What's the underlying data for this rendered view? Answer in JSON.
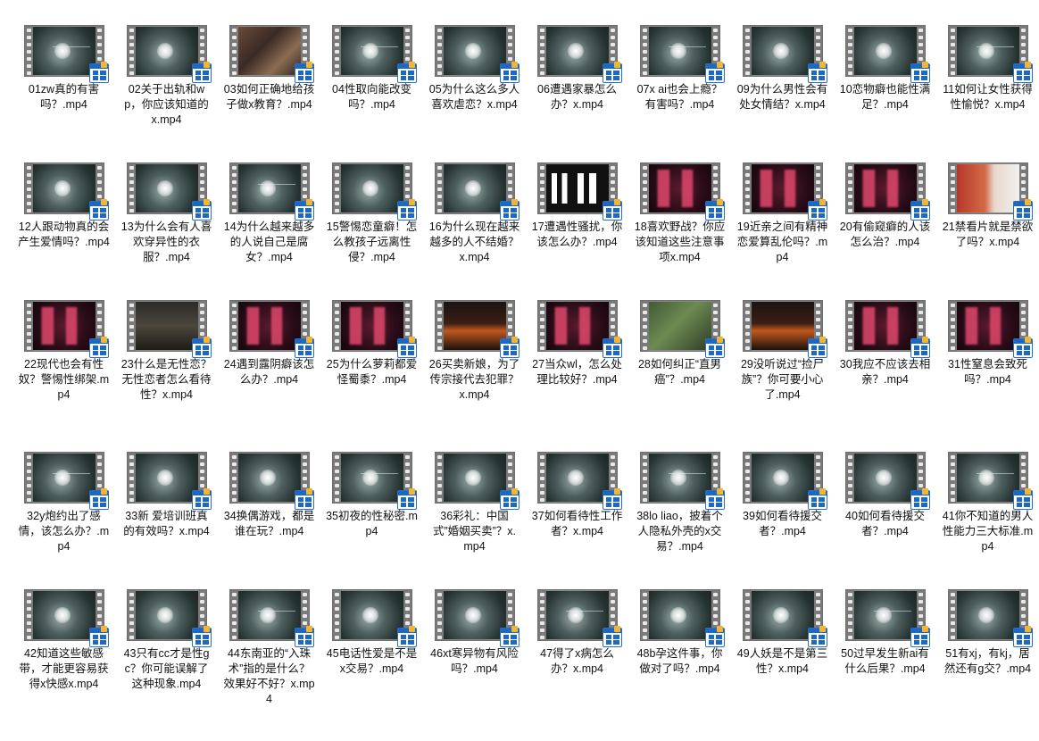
{
  "files": [
    {
      "name": "01zw真的有害吗？.mp4",
      "thumb": "teal"
    },
    {
      "name": "02关于出轨和wp，你应该知道的x.mp4",
      "thumb": "teal"
    },
    {
      "name": "03如何正确地给孩子做x教育？.mp4",
      "thumb": "photo"
    },
    {
      "name": "04性取向能改变吗？.mp4",
      "thumb": "teal"
    },
    {
      "name": "05为什么这么多人喜欢虐恋？x.mp4",
      "thumb": "teal"
    },
    {
      "name": "06遭遇家暴怎么办？x.mp4",
      "thumb": "teal"
    },
    {
      "name": "07x ai也会上瘾？有害吗？.mp4",
      "thumb": "teal"
    },
    {
      "name": "09为什么男性会有处女情结？x.mp4",
      "thumb": "teal"
    },
    {
      "name": "10恋物癖也能性满足？.mp4",
      "thumb": "teal"
    },
    {
      "name": "11如何让女性获得性愉悦？x.mp4",
      "thumb": "teal"
    },
    {
      "name": "12人跟动物真的会产生爱情吗？.mp4",
      "thumb": "teal"
    },
    {
      "name": "13为什么会有人喜欢穿异性的衣服？.mp4",
      "thumb": "teal"
    },
    {
      "name": "14为什么越来越多的人说自己是腐女？.mp4",
      "thumb": "teal"
    },
    {
      "name": "15警惕恋童癖！怎么教孩子远离性侵？.mp4",
      "thumb": "teal"
    },
    {
      "name": "16为什么现在越来越多的人不结婚？x.mp4",
      "thumb": "teal"
    },
    {
      "name": "17遭遇性骚扰，你该怎么办？.mp4",
      "thumb": "white"
    },
    {
      "name": "18喜欢野战？你应该知道这些注意事项x.mp4",
      "thumb": "red"
    },
    {
      "name": "19近亲之间有精神恋爱算乱伦吗？.mp4",
      "thumb": "red"
    },
    {
      "name": "20有偷窥癖的人该怎么治？.mp4",
      "thumb": "red"
    },
    {
      "name": "21禁看片就是禁欲了吗？x.mp4",
      "thumb": "retro"
    },
    {
      "name": "22现代也会有性奴？警惕性绑架.mp4",
      "thumb": "red"
    },
    {
      "name": "23什么是无性恋？无性恋者怎么看待性？x.mp4",
      "thumb": "dark"
    },
    {
      "name": "24遇到露阴癖该怎么办？.mp4",
      "thumb": "red"
    },
    {
      "name": "25为什么萝莉都爱怪蜀黍？.mp4",
      "thumb": "red"
    },
    {
      "name": "26买卖新娘，为了传宗接代去犯罪？x.mp4",
      "thumb": "fire"
    },
    {
      "name": "27当众wl，怎么处理比较好？.mp4",
      "thumb": "red"
    },
    {
      "name": "28如何纠正“直男癌”？.mp4",
      "thumb": "forest"
    },
    {
      "name": "29没听说过“捡尸族”？你可要小心了.mp4",
      "thumb": "fire"
    },
    {
      "name": "30我应不应该去相亲？.mp4",
      "thumb": "red"
    },
    {
      "name": "31性窒息会致死吗？.mp4",
      "thumb": "red"
    },
    {
      "name": "32y炮约出了感情，该怎么办？.mp4",
      "thumb": "teal"
    },
    {
      "name": "33新 爱培训班真的有效吗？x.mp4",
      "thumb": "teal"
    },
    {
      "name": "34换偶游戏，都是谁在玩？.mp4",
      "thumb": "teal"
    },
    {
      "name": "35初夜的性秘密.mp4",
      "thumb": "teal"
    },
    {
      "name": "36彩礼：中国式”婚姻买卖”？x.mp4",
      "thumb": "teal"
    },
    {
      "name": "37如何看待性工作者？x.mp4",
      "thumb": "teal"
    },
    {
      "name": "38lo liao，披着个人隐私外壳的x交易？.mp4",
      "thumb": "teal"
    },
    {
      "name": "39如何看待援交者？.mp4",
      "thumb": "teal"
    },
    {
      "name": "40如何看待援交者？.mp4",
      "thumb": "teal"
    },
    {
      "name": "41你不知道的男人性能力三大标准.mp4",
      "thumb": "teal"
    },
    {
      "name": "42知道这些敏感带，才能更容易获得x快感x.mp4",
      "thumb": "teal"
    },
    {
      "name": "43只有cc才是性gc？你可能误解了这种现象.mp4",
      "thumb": "teal"
    },
    {
      "name": "44东南亚的“入珠术”指的是什么？效果好不好？x.mp4",
      "thumb": "teal"
    },
    {
      "name": "45电话性爱是不是x交易？.mp4",
      "thumb": "teal"
    },
    {
      "name": "46xt寒异物有风险吗？.mp4",
      "thumb": "teal"
    },
    {
      "name": "47得了x病怎么办？x.mp4",
      "thumb": "teal"
    },
    {
      "name": "48b孕这件事，你做对了吗？.mp4",
      "thumb": "teal"
    },
    {
      "name": "49人妖是不是第三性？x.mp4",
      "thumb": "teal"
    },
    {
      "name": "50过早发生新ai有什么后果？.mp4",
      "thumb": "teal"
    },
    {
      "name": "51有xj，有kj，居然还有g交？.mp4",
      "thumb": "teal"
    }
  ],
  "icons": {
    "file_badge": "video-file-icon",
    "thumbnail": "film-strip-thumbnail"
  }
}
